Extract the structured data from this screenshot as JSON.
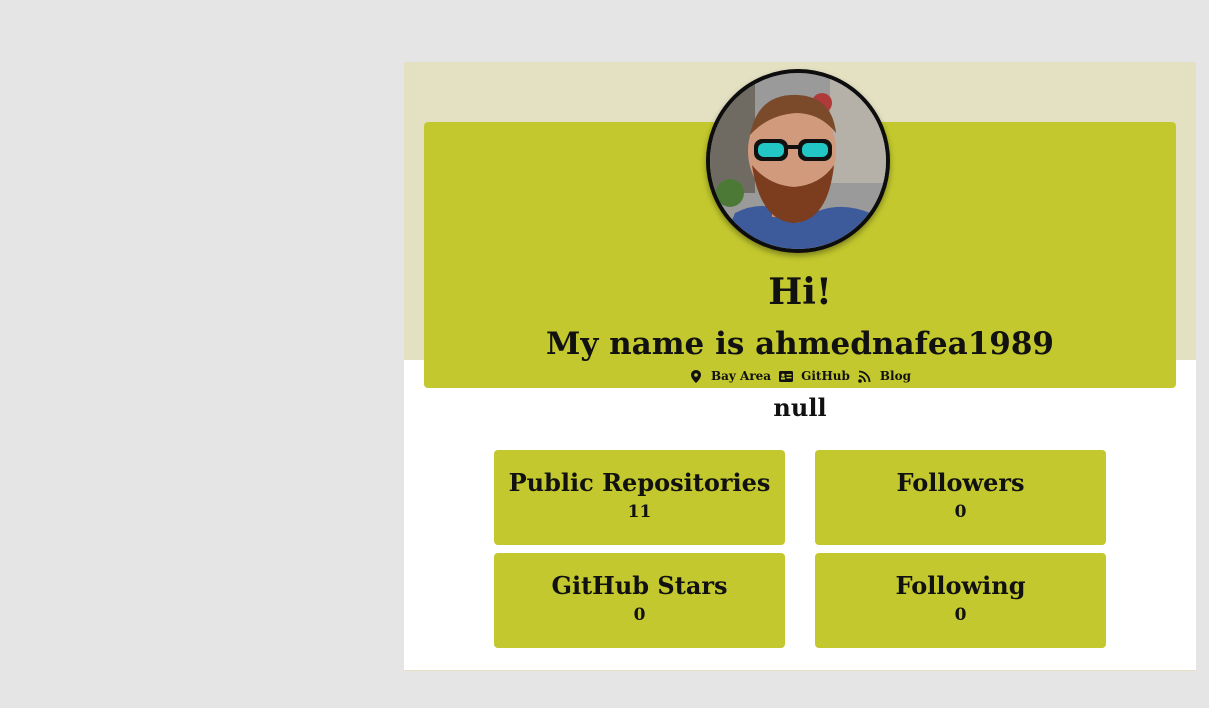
{
  "profile": {
    "greeting": "Hi!",
    "name_line": "My name is ahmednafea1989",
    "bio": "null",
    "avatar_alt": "profile-photo"
  },
  "links": {
    "location": "Bay Area",
    "github": "GitHub",
    "blog": "Blog"
  },
  "stats": {
    "public_repos": {
      "label": "Public Repositories",
      "value": "11"
    },
    "followers": {
      "label": "Followers",
      "value": "0"
    },
    "github_stars": {
      "label": "GitHub Stars",
      "value": "0"
    },
    "following": {
      "label": "Following",
      "value": "0"
    }
  },
  "colors": {
    "page_bg": "#e5e5e5",
    "card_bg": "#ffffff",
    "card_top_bg": "#e4e1c3",
    "accent": "#c2c82d",
    "text": "#111111"
  },
  "icons": {
    "location": "map-marker-icon",
    "github": "id-card-icon",
    "blog": "rss-icon"
  }
}
